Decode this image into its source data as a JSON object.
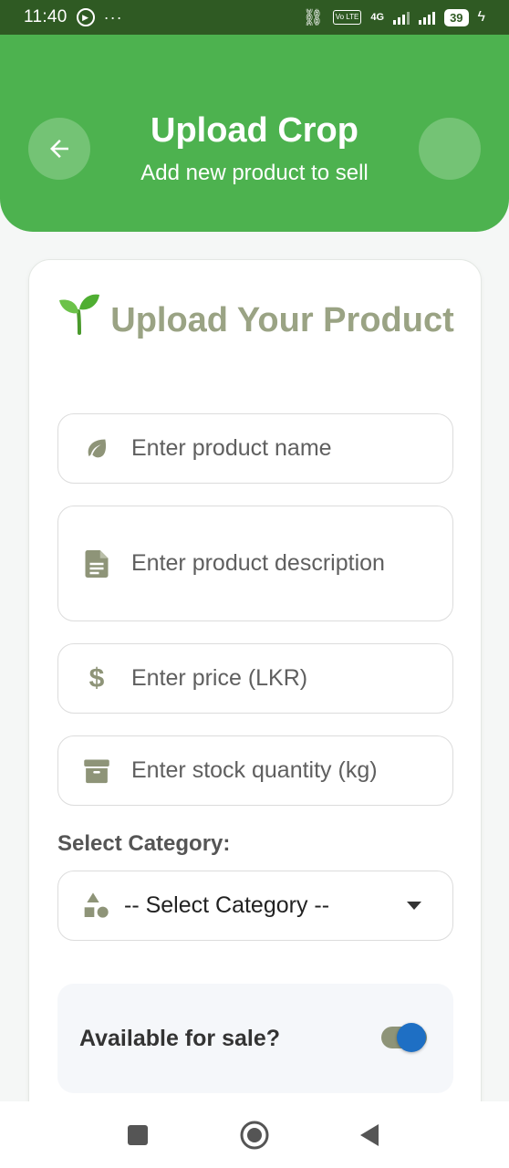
{
  "status_bar": {
    "time": "11:40",
    "dots": "···",
    "network": "4G",
    "volte": "Vo LTE",
    "battery": "39"
  },
  "header": {
    "title": "Upload Crop",
    "subtitle": "Add new product to sell"
  },
  "form": {
    "heading": "Upload Your Product",
    "heading_emoji": "sprout",
    "fields": {
      "name_placeholder": "Enter product name",
      "description_placeholder": "Enter product description",
      "price_placeholder": "Enter price (LKR)",
      "stock_placeholder": "Enter stock quantity (kg)"
    },
    "category_label": "Select Category:",
    "category_selected": "-- Select Category --",
    "available_label": "Available for sale?",
    "available_for_sale": true
  },
  "colors": {
    "header_green": "#4db24f",
    "status_green": "#2f5a23",
    "heading_olive": "#9aa384",
    "toggle_blue": "#1e6fc4"
  },
  "icons": [
    "back-arrow-icon",
    "leaf-icon",
    "document-icon",
    "dollar-icon",
    "archive-box-icon",
    "shapes-icon",
    "caret-down-icon",
    "sprout-icon",
    "recents-square-icon",
    "home-circle-icon",
    "back-triangle-icon"
  ]
}
